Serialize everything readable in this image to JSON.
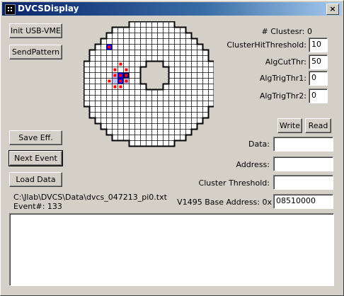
{
  "window": {
    "title": "DVCSDisplay",
    "close_glyph": "×"
  },
  "buttons": {
    "init": "Init USB-VME",
    "send_pattern": "SendPattern",
    "save_eff": "Save Eff.",
    "next_event": "Next Event",
    "load_data": "Load Data",
    "write": "Write",
    "read": "Read"
  },
  "params": {
    "clusters_label": "# Clustesr: 0",
    "cluster_hit_threshold_label": "ClusterHitThreshold:",
    "cluster_hit_threshold_value": "10",
    "alg_cut_thr_label": "AlgCutThr:",
    "alg_cut_thr_value": "50",
    "alg_trig_thr1_label": "AlgTrigThr1:",
    "alg_trig_thr1_value": "0",
    "alg_trig_thr2_label": "AlgTrigThr2:",
    "alg_trig_thr2_value": "0"
  },
  "vme": {
    "data_label": "Data:",
    "data_value": "",
    "address_label": "Address:",
    "address_value": "",
    "cluster_threshold_label": "Cluster Threshold:",
    "cluster_threshold_value": "",
    "base_address_label": "V1495 Base Address: 0x",
    "base_address_value": "08510000"
  },
  "status": {
    "file_path": "C:\\Jlab\\DVCS\\Data\\dvcs_047213_pi0.txt",
    "event": "Event#: 133"
  },
  "log": {
    "text": ""
  },
  "colors": {
    "hit_blue": "#0000ff",
    "hit_light": "#c0c0ff",
    "hit_red": "#ff0000",
    "dark_blue": "#000080"
  },
  "detector_grid": {
    "cols": 23,
    "rows": 22,
    "row_ranges": [
      [
        8,
        15
      ],
      [
        5,
        17
      ],
      [
        4,
        18
      ],
      [
        3,
        19
      ],
      [
        2,
        20
      ],
      [
        1,
        21
      ],
      [
        1,
        21
      ],
      [
        0,
        22
      ],
      [
        0,
        22
      ],
      [
        0,
        22
      ],
      [
        0,
        22
      ],
      [
        0,
        22
      ],
      [
        0,
        22
      ],
      [
        0,
        22
      ],
      [
        0,
        22
      ],
      [
        1,
        21
      ],
      [
        1,
        21
      ],
      [
        2,
        20
      ],
      [
        3,
        19
      ],
      [
        4,
        18
      ],
      [
        5,
        17
      ],
      [
        8,
        15
      ]
    ],
    "hole": [
      [
        7,
        11
      ],
      [
        7,
        12
      ],
      [
        7,
        13
      ],
      [
        8,
        10
      ],
      [
        8,
        11
      ],
      [
        8,
        12
      ],
      [
        8,
        13
      ],
      [
        8,
        14
      ],
      [
        9,
        10
      ],
      [
        9,
        11
      ],
      [
        9,
        12
      ],
      [
        9,
        13
      ],
      [
        9,
        14
      ],
      [
        10,
        10
      ],
      [
        10,
        11
      ],
      [
        10,
        12
      ],
      [
        10,
        13
      ],
      [
        10,
        14
      ],
      [
        11,
        11
      ],
      [
        11,
        12
      ],
      [
        11,
        13
      ]
    ],
    "hits": [
      {
        "row": 4,
        "col": 4,
        "fill": "hit_blue",
        "dot": "hit_red"
      },
      {
        "row": 7,
        "col": 6,
        "dot": "hit_red"
      },
      {
        "row": 8,
        "col": 5,
        "dot": "hit_red"
      },
      {
        "row": 8,
        "col": 7,
        "dot": "hit_red"
      },
      {
        "row": 9,
        "col": 5,
        "fill": "hit_light",
        "dot": "hit_red"
      },
      {
        "row": 9,
        "col": 6,
        "fill": "hit_blue",
        "dot": "hit_red"
      },
      {
        "row": 9,
        "col": 7,
        "fill": "dark_blue",
        "dot": "hit_red"
      },
      {
        "row": 10,
        "col": 4,
        "dot": "hit_red"
      },
      {
        "row": 10,
        "col": 5,
        "fill": "hit_light"
      },
      {
        "row": 10,
        "col": 6,
        "fill": "hit_blue",
        "dot": "hit_red"
      },
      {
        "row": 10,
        "col": 7,
        "fill": "hit_light",
        "dot": "hit_red"
      },
      {
        "row": 11,
        "col": 5,
        "dot": "hit_red"
      },
      {
        "row": 11,
        "col": 6,
        "dot": "hit_red"
      }
    ]
  }
}
